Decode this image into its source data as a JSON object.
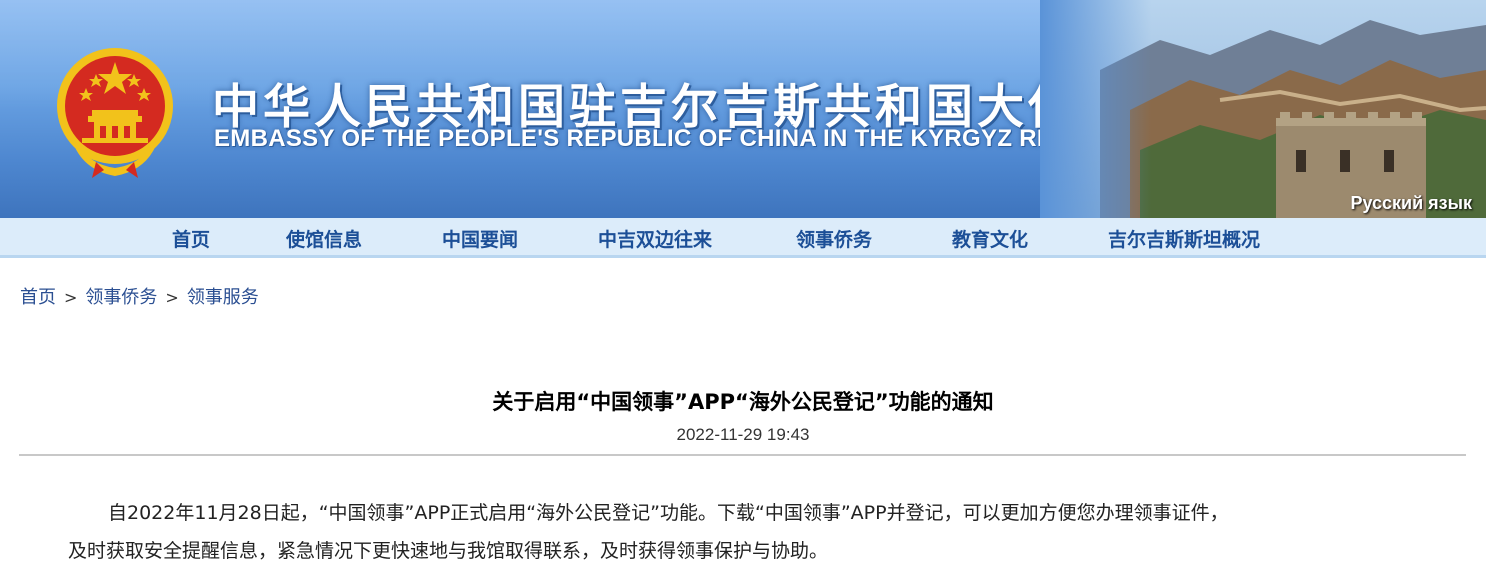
{
  "banner": {
    "title_cn": "中华人民共和国驻吉尔吉斯共和国大使馆",
    "title_en": "EMBASSY OF THE PEOPLE'S REPUBLIC OF CHINA IN THE KYRGYZ REPUBLIC",
    "language_link": "Русский язык"
  },
  "nav": {
    "items": [
      {
        "label": "首页"
      },
      {
        "label": "使馆信息"
      },
      {
        "label": "中国要闻"
      },
      {
        "label": "中吉双边往来"
      },
      {
        "label": "领事侨务"
      },
      {
        "label": "教育文化"
      },
      {
        "label": "吉尔吉斯斯坦概况"
      }
    ]
  },
  "breadcrumb": {
    "items": [
      "首页",
      "领事侨务",
      "领事服务"
    ],
    "separator": ">"
  },
  "article": {
    "title": "关于启用“中国领事”APP“海外公民登记”功能的通知",
    "date": "2022-11-29 19:43",
    "body_lines": [
      "自2022年11月28日起，“中国领事”APP正式启用“海外公民登记”功能。下载“中国领事”APP并登记，可以更加方便您办理领事证件，",
      "及时获取安全提醒信息，紧急情况下更快速地与我馆取得联系，及时获得领事保护与协助。"
    ]
  },
  "colors": {
    "banner_blue": "#6aa3e4",
    "nav_bg": "#dcecfa",
    "nav_text": "#1c4f97",
    "link": "#2b4f92",
    "emblem_red": "#d42a20",
    "emblem_gold": "#f2c21b"
  },
  "icons": {
    "emblem": "national-emblem-icon",
    "scenery": "great-wall-image"
  }
}
